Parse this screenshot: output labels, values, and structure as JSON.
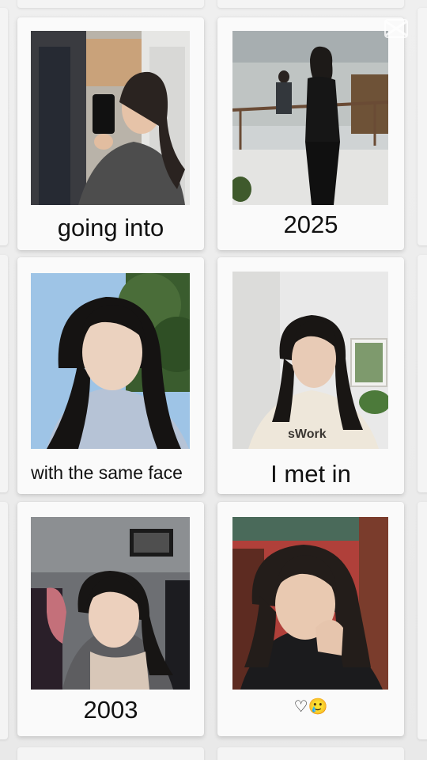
{
  "polaroids": [
    {
      "caption": "going into",
      "photo_subject": "mirror selfie with phone"
    },
    {
      "caption": "2025",
      "photo_subject": "woman in black outfit sitting in building atrium"
    },
    {
      "caption": "with the same face",
      "photo_subject": "outdoor selfie with trees and blue sky"
    },
    {
      "caption": "I met in",
      "photo_subject": "indoor selfie in cream sweatshirt"
    },
    {
      "caption": "2003",
      "photo_subject": "selfie on a bus seat with scarf"
    },
    {
      "caption": "♡🥲",
      "photo_subject": "selfie with hand on chin in red room"
    }
  ],
  "watermark_icon": "capcut-logo-icon",
  "colors": {
    "background": "#ececec",
    "frame": "#fafafa",
    "caption_text": "#111111"
  }
}
